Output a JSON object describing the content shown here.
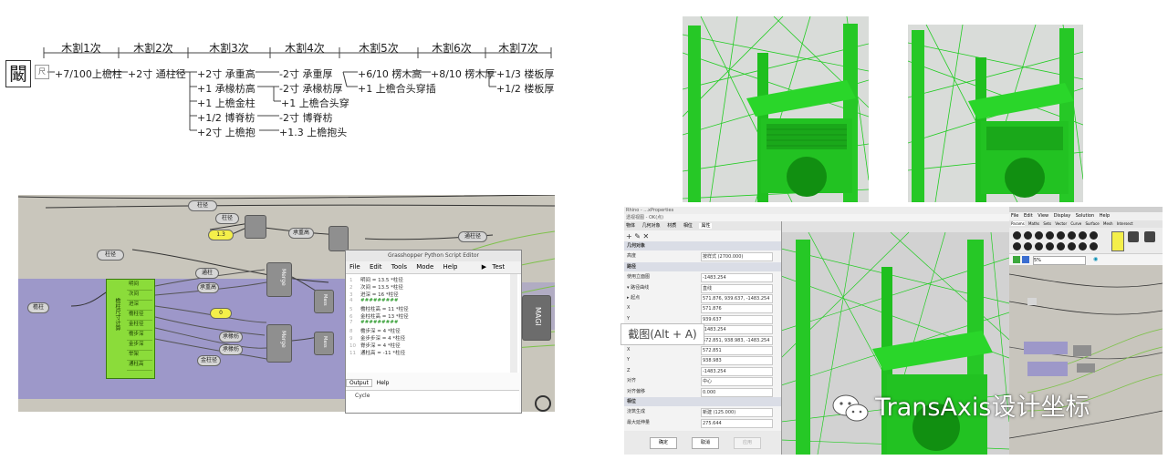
{
  "tree": {
    "root_char": "闞",
    "root_small": "尺",
    "headers": [
      "木割1次",
      "木割2次",
      "木割3次",
      "木割4次",
      "木割5次",
      "木割6次",
      "木割7次"
    ],
    "col1": [
      "+7/100上檐柱"
    ],
    "col2": [
      "+2寸 通柱径"
    ],
    "col3": [
      "+2寸 承重高",
      "+1  承椽枋高",
      "+1  上檐金柱",
      "+1/2  博脊枋",
      "+2寸  上檐抱"
    ],
    "col4": [
      "-2寸  承重厚",
      "-2寸  承椽枋厚",
      "+1 上檐合头穿",
      "-2寸  博脊枋",
      "+1.3 上檐抱头"
    ],
    "col5": [
      "+6/10 楞木高",
      "+1  上檐合头穿插"
    ],
    "col6": [
      "+8/10 楞木厚"
    ],
    "col7": [
      "+1/3 楼板厚",
      "+1/2 楼板厚"
    ]
  },
  "gh": {
    "params": [
      "柱径",
      "1.3",
      "柱径",
      "柱径",
      "承重高",
      "通柱径",
      "柱径",
      "檐柱",
      "通柱",
      "承重高",
      "0",
      "承椽枋",
      "承椽枋",
      "金柱径"
    ],
    "green_title": "檐柱尺寸计算",
    "green_rows": [
      "明间",
      "次间",
      "进深",
      "檐柱径",
      "金柱径",
      "檐步深",
      "金步深",
      "举架",
      "通柱高"
    ],
    "comps": [
      "Merge",
      "Merge",
      "Mass",
      "Mass",
      "Mass",
      "Mass"
    ],
    "right_comp": "MAGI",
    "python_editor": {
      "title": "Grasshopper Python Script Editor",
      "menu": [
        "File",
        "Edit",
        "Tools",
        "Mode",
        "Help"
      ],
      "test": "Test",
      "ok": "OK",
      "lines": [
        {
          "n": "1",
          "code": "明间 = 13.5 *柱径"
        },
        {
          "n": "2",
          "code": "次间 = 13.5 *柱径"
        },
        {
          "n": "3",
          "code": "进深 = 16 *柱径"
        },
        {
          "n": "4",
          "code": "#########"
        },
        {
          "n": "5",
          "code": "檐柱柱高 = 11 *柱径"
        },
        {
          "n": "6",
          "code": "金柱柱高 = 13 *柱径"
        },
        {
          "n": "7",
          "code": "#########"
        },
        {
          "n": "8",
          "code": "檐步深 = 4 *柱径"
        },
        {
          "n": "9",
          "code": "金步步深 = 4 *柱径"
        },
        {
          "n": "10",
          "code": "脊步深 = 4 *柱径"
        },
        {
          "n": "11",
          "code": "通柱高 = -11 *柱径"
        }
      ],
      "tabs": [
        "Output",
        "Help"
      ],
      "output": "Cycle"
    }
  },
  "rhino": {
    "title": "Rhino - ...xProperties",
    "sub": "透视视图 - OK(点)",
    "tabs": [
      "物体",
      "几何对象",
      "材质",
      "相位",
      "属性"
    ],
    "props": [
      {
        "label": "几何对象",
        "value": "",
        "section": true
      },
      {
        "label": "高度",
        "value": "按样式 (2700.000)",
        "section": false
      },
      {
        "label": "路径",
        "value": "",
        "section": true
      },
      {
        "label": "使用立面图",
        "value": "-1483.254",
        "section": false
      },
      {
        "label": "▾ 路径曲线",
        "value": "直线",
        "section": false
      },
      {
        "label": "  ▸ 起点",
        "value": "571.876, 939.637, -1483.254",
        "section": false
      },
      {
        "label": "      X",
        "value": "571.876",
        "section": false
      },
      {
        "label": "      Y",
        "value": "939.637",
        "section": false
      },
      {
        "label": "      Z",
        "value": "-1483.254",
        "section": false
      },
      {
        "label": "  ▸ 终点",
        "value": "572.851, 938.983, -1483.254",
        "section": false
      },
      {
        "label": "      X",
        "value": "572.851",
        "section": false
      },
      {
        "label": "      Y",
        "value": "938.983",
        "section": false
      },
      {
        "label": "      Z",
        "value": "-1483.254",
        "section": false
      },
      {
        "label": "对齐",
        "value": "中心",
        "section": false
      },
      {
        "label": "对齐偏移",
        "value": "0.000",
        "section": false
      },
      {
        "label": "相位",
        "value": "",
        "section": true
      },
      {
        "label": "浇筑生成",
        "value": "新建 (125.000)",
        "section": false
      },
      {
        "label": "最大延伸量",
        "value": "275.644",
        "section": false
      }
    ],
    "buttons": [
      "确定",
      "取消",
      "应用"
    ],
    "gh_menu": [
      "File",
      "Edit",
      "View",
      "Display",
      "Solution",
      "Help"
    ],
    "gh_tabs": [
      "Params",
      "Maths",
      "Sets",
      "Vector",
      "Curve",
      "Surface",
      "Mesh",
      "Intersect"
    ],
    "zoom": "5%"
  },
  "tooltip": "截图(Alt + A)",
  "watermark": "TransAxis设计坐标",
  "colors": {
    "green": "#22cc22",
    "purple": "#9d98c9",
    "canvas": "#c9c6bc"
  }
}
